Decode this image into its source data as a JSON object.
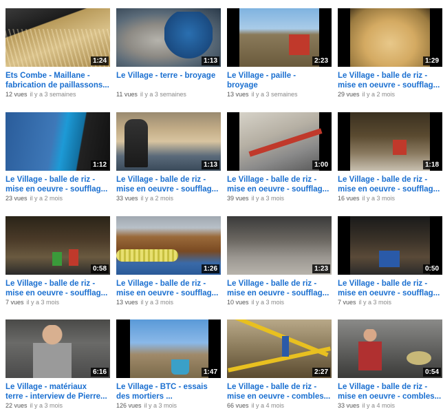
{
  "videos": [
    {
      "title1": "Ets Combe - Maillane -",
      "title2": "fabrication de paillassons...",
      "views": "12 vues",
      "ago": "il y a 3 semaines",
      "duration": "1:24"
    },
    {
      "title1": "Le Village - terre - broyage",
      "title2": "",
      "views": "11 vues",
      "ago": "il y a 3 semaines",
      "duration": "1:13"
    },
    {
      "title1": "Le Village - paille -",
      "title2": "broyage",
      "views": "13 vues",
      "ago": "il y a 3 semaines",
      "duration": "2:23"
    },
    {
      "title1": "Le Village - balle de riz -",
      "title2": "mise en oeuvre - soufflag...",
      "views": "29 vues",
      "ago": "il y a 2 mois",
      "duration": "1:29"
    },
    {
      "title1": "Le Village - balle de riz -",
      "title2": "mise en oeuvre - soufflag...",
      "views": "23 vues",
      "ago": "il y a 2 mois",
      "duration": "1:12"
    },
    {
      "title1": "Le Village - balle de riz -",
      "title2": "mise en oeuvre - soufflag...",
      "views": "33 vues",
      "ago": "il y a 2 mois",
      "duration": "1:13"
    },
    {
      "title1": "Le Village - balle de riz -",
      "title2": "mise en oeuvre - soufflag...",
      "views": "39 vues",
      "ago": "il y a 3 mois",
      "duration": "1:00"
    },
    {
      "title1": "Le Village - balle de riz -",
      "title2": "mise en oeuvre - soufflag...",
      "views": "16 vues",
      "ago": "il y a 3 mois",
      "duration": "1:18"
    },
    {
      "title1": "Le Village - balle de riz -",
      "title2": "mise en oeuvre - soufflag...",
      "views": "7 vues",
      "ago": "il y a 3 mois",
      "duration": "0:58"
    },
    {
      "title1": "Le Village - balle de riz -",
      "title2": "mise en oeuvre - soufflag...",
      "views": "13 vues",
      "ago": "il y a 3 mois",
      "duration": "1:26"
    },
    {
      "title1": "Le Village - balle de riz -",
      "title2": "mise en oeuvre - soufflag...",
      "views": "10 vues",
      "ago": "il y a 3 mois",
      "duration": "1:23"
    },
    {
      "title1": "Le Village - balle de riz -",
      "title2": "mise en oeuvre - soufflag...",
      "views": "7 vues",
      "ago": "il y a 3 mois",
      "duration": "0:50"
    },
    {
      "title1": "Le Village - matériaux",
      "title2": "terre - interview de Pierre...",
      "views": "22 vues",
      "ago": "il y a 3 mois",
      "duration": "6:16"
    },
    {
      "title1": "Le Village - BTC - essais",
      "title2": "des mortiers ...",
      "views": "126 vues",
      "ago": "il y a 3 mois",
      "duration": "1:47"
    },
    {
      "title1": "Le Village - balle de riz -",
      "title2": "mise en oeuvre - combles...",
      "views": "66 vues",
      "ago": "il y a 4 mois",
      "duration": "2:27"
    },
    {
      "title1": "Le Village - balle de riz -",
      "title2": "mise en oeuvre - combles...",
      "views": "33 vues",
      "ago": "il y a 4 mois",
      "duration": "0:54"
    }
  ]
}
